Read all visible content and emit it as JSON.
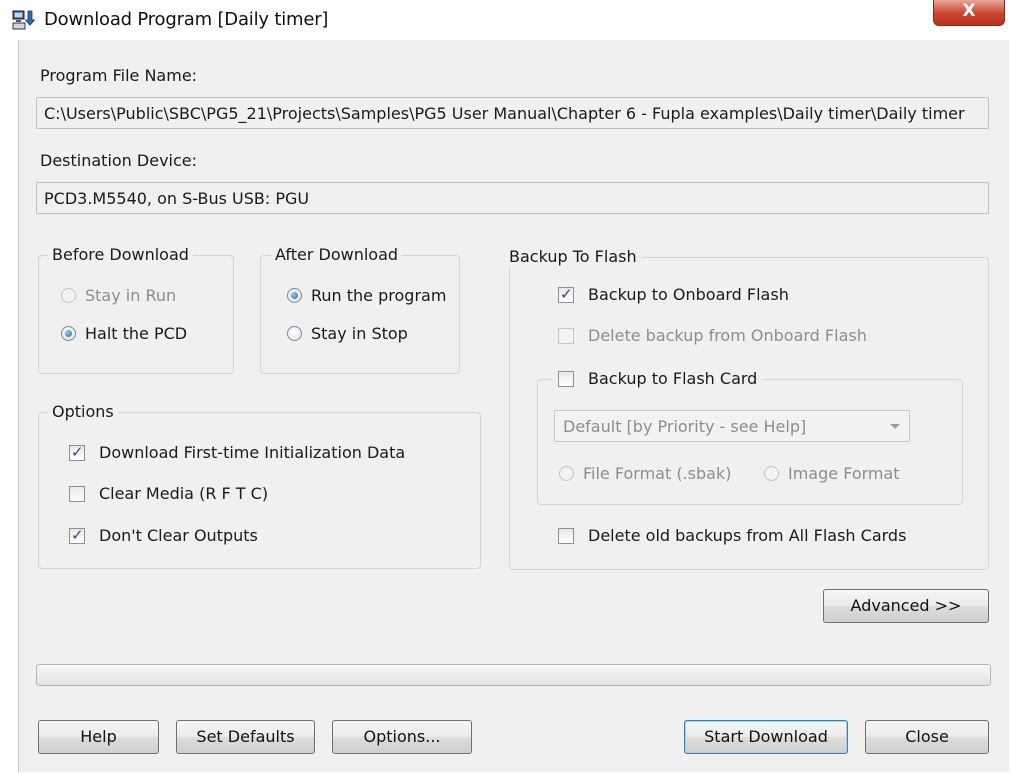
{
  "window": {
    "title": "Download Program [Daily timer]",
    "close_symbol": "X",
    "icon": "download-computer-icon"
  },
  "program_file": {
    "label": "Program File Name:",
    "value": "C:\\Users\\Public\\SBC\\PG5_21\\Projects\\Samples\\PG5 User Manual\\Chapter 6 - Fupla examples\\Daily timer\\Daily timer"
  },
  "destination": {
    "label": "Destination Device:",
    "value": "PCD3.M5540, on S-Bus USB: PGU"
  },
  "before_download": {
    "title": "Before Download",
    "options": [
      {
        "label": "Stay in Run",
        "selected": false,
        "enabled": false
      },
      {
        "label": "Halt the PCD",
        "selected": true,
        "enabled": true
      }
    ]
  },
  "after_download": {
    "title": "After Download",
    "options": [
      {
        "label": "Run the program",
        "selected": true
      },
      {
        "label": "Stay in Stop",
        "selected": false
      }
    ]
  },
  "options_group": {
    "title": "Options",
    "items": [
      {
        "label": "Download First-time Initialization Data",
        "checked": true
      },
      {
        "label": "Clear Media (R F T C)",
        "checked": false
      },
      {
        "label": "Don't Clear Outputs",
        "checked": true
      }
    ]
  },
  "backup_to_flash": {
    "title": "Backup To Flash",
    "onboard": {
      "label": "Backup to Onboard Flash",
      "checked": true
    },
    "delete_onboard": {
      "label": "Delete backup from Onboard Flash",
      "checked": false,
      "enabled": false
    },
    "flash_card": {
      "label": "Backup to Flash Card",
      "checked": false,
      "selected_option": "Default [by Priority - see Help]",
      "formats": [
        {
          "label": "File Format (.sbak)",
          "selected": false
        },
        {
          "label": "Image Format",
          "selected": false
        }
      ]
    },
    "delete_all": {
      "label": "Delete old backups from All Flash Cards",
      "checked": false
    }
  },
  "advanced_label": "Advanced >>",
  "progress": {
    "value": 0
  },
  "buttons": {
    "help": "Help",
    "set_defaults": "Set Defaults",
    "options": "Options...",
    "start_download": "Start Download",
    "close": "Close"
  }
}
